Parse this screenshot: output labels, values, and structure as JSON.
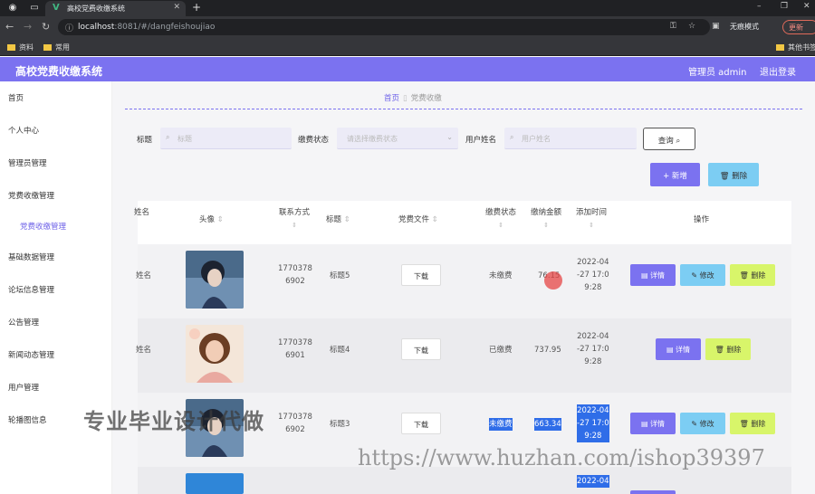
{
  "browser": {
    "tab_title": "高校党费收缴系统",
    "url_host": "localhost",
    "url_rest": ":8081/#/dangfeishoujiao",
    "incognito_label": "无痕模式",
    "update_label": "更新",
    "bookmarks": [
      "资料",
      "常用",
      "其他书签"
    ]
  },
  "header": {
    "title": "高校党费收缴系统",
    "user": "管理员 admin",
    "logout": "退出登录",
    "accent": "#7b72f0"
  },
  "sidebar": {
    "items": [
      "首页",
      "个人中心",
      "管理员管理",
      "党费收缴管理",
      "党费收缴管理",
      "基础数据管理",
      "论坛信息管理",
      "公告管理",
      "新闻动态管理",
      "用户管理",
      "轮播图信息"
    ]
  },
  "breadcrumb": {
    "home": "首页",
    "current": "党费收缴"
  },
  "search": {
    "title_label": "标题",
    "title_placeholder": "标题",
    "status_label": "缴费状态",
    "status_placeholder": "请选择缴费状态",
    "user_label": "用户姓名",
    "user_placeholder": "用户姓名",
    "query_button": "查询"
  },
  "actions": {
    "add": "新增",
    "delete": "删除"
  },
  "table": {
    "headers": [
      "姓名",
      "头像",
      "联系方式",
      "标题",
      "党费文件",
      "缴费状态",
      "缴纳金额",
      "添加时间",
      "操作"
    ],
    "download_label": "下载",
    "op_detail": "详情",
    "op_edit": "修改",
    "op_delete": "删除",
    "rows": [
      {
        "name": "姓名",
        "phone": [
          "1770378",
          "6902"
        ],
        "title": "标题5",
        "status": "未缴费",
        "amount": "76.15",
        "time": [
          "2022-04",
          "-27 17:0",
          "9:28"
        ]
      },
      {
        "name": "姓名",
        "phone": [
          "1770378",
          "6901"
        ],
        "title": "标题4",
        "status": "已缴费",
        "amount": "737.95",
        "time": [
          "2022-04",
          "-27 17:0",
          "9:28"
        ]
      },
      {
        "name": "姓名",
        "phone": [
          "1770378",
          "6902"
        ],
        "title": "标题3",
        "status": "未缴费",
        "amount": "663.34",
        "time": [
          "2022-04",
          "-27 17:0",
          "9:28"
        ]
      },
      {
        "time": [
          "2022-04"
        ]
      }
    ]
  },
  "watermarks": {
    "cn": "专业毕业设计代做",
    "url": "https://www.huzhan.com/ishop39397"
  }
}
